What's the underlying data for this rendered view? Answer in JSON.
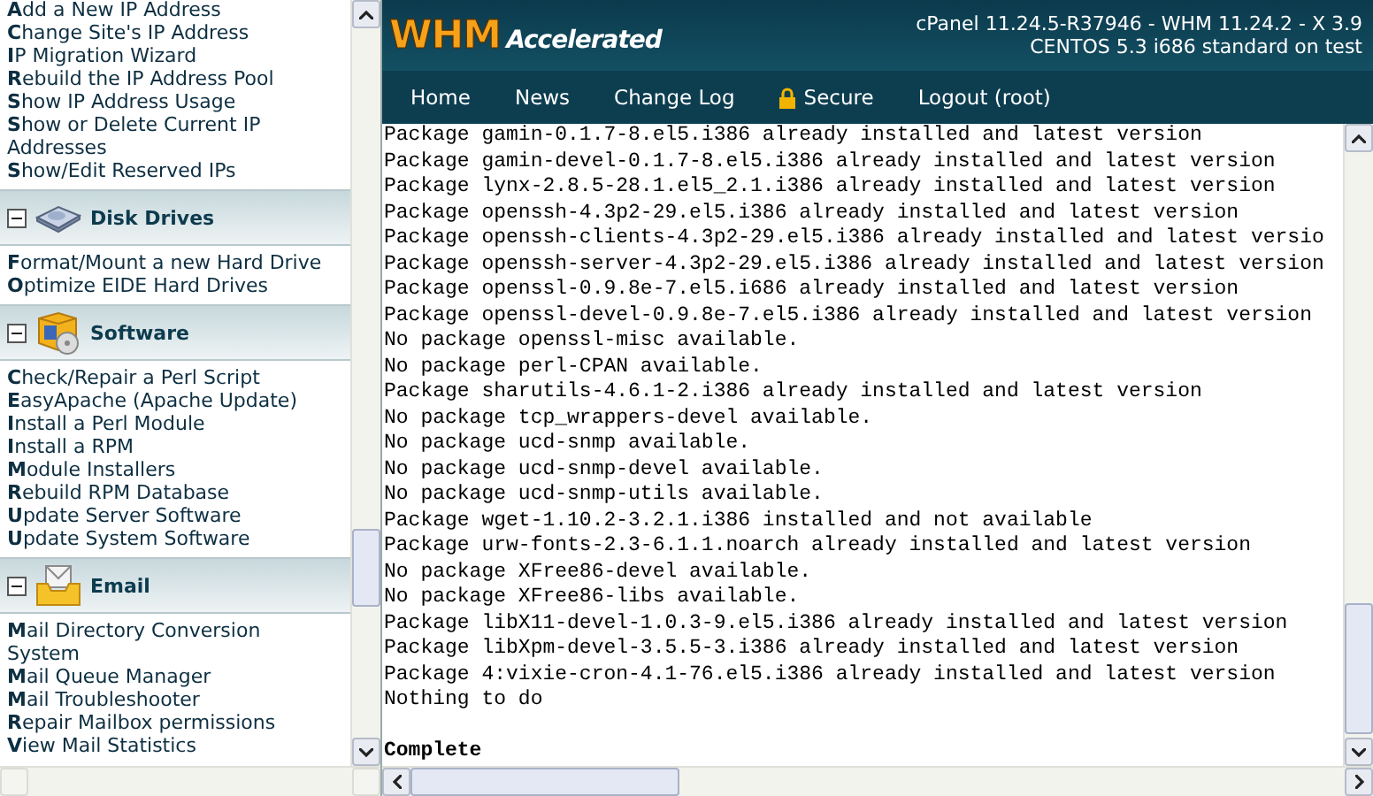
{
  "sidebar": {
    "items_top": [
      "**A**dd a New IP Address",
      "**C**hange Site's IP Address",
      "**I**P Migration Wizard",
      "**R**ebuild the IP Address Pool",
      "**S**how IP Address Usage",
      "**S**how or Delete Current IP Addresses",
      "**S**how/Edit Reserved IPs"
    ],
    "sections": [
      {
        "title": "Disk Drives",
        "kind": "disk",
        "expanded": true,
        "items": [
          "**F**ormat/Mount a new Hard Drive",
          "**O**ptimize EIDE Hard Drives"
        ]
      },
      {
        "title": "Software",
        "kind": "software",
        "expanded": true,
        "items": [
          "**C**heck/Repair a Perl Script",
          "**E**asyApache (Apache Update)",
          "**I**nstall a Perl Module",
          "**I**nstall a RPM",
          "**M**odule Installers",
          "**R**ebuild RPM Database",
          "**U**pdate Server Software",
          "**U**pdate System Software"
        ]
      },
      {
        "title": "Email",
        "kind": "email",
        "expanded": true,
        "items": [
          "**M**ail Directory Conversion System",
          "**M**ail Queue Manager",
          "**M**ail Troubleshooter",
          "**R**epair Mailbox permissions",
          "**V**iew Mail Statistics"
        ]
      }
    ]
  },
  "header": {
    "logo_main": "WHM",
    "logo_sub": "Accelerated",
    "version_lines": [
      "cPanel 11.24.5-R37946 - WHM 11.24.2 - X 3.9",
      "CENTOS 5.3 i686 standard on test"
    ]
  },
  "nav": [
    {
      "label": "Home"
    },
    {
      "label": "News"
    },
    {
      "label": "Change Log"
    },
    {
      "label": "Secure",
      "kind": "secure"
    },
    {
      "label": "Logout (root)"
    }
  ],
  "console": {
    "lines": [
      "Package gamin-0.1.7-8.el5.i386 already installed and latest version",
      "Package gamin-devel-0.1.7-8.el5.i386 already installed and latest version",
      "Package lynx-2.8.5-28.1.el5_2.1.i386 already installed and latest version",
      "Package openssh-4.3p2-29.el5.i386 already installed and latest version",
      "Package openssh-clients-4.3p2-29.el5.i386 already installed and latest versio",
      "Package openssh-server-4.3p2-29.el5.i386 already installed and latest version",
      "Package openssl-0.9.8e-7.el5.i686 already installed and latest version",
      "Package openssl-devel-0.9.8e-7.el5.i386 already installed and latest version",
      "No package openssl-misc available.",
      "No package perl-CPAN available.",
      "Package sharutils-4.6.1-2.i386 already installed and latest version",
      "No package tcp_wrappers-devel available.",
      "No package ucd-snmp available.",
      "No package ucd-snmp-devel available.",
      "No package ucd-snmp-utils available.",
      "Package wget-1.10.2-3.2.1.i386 installed and not available",
      "Package urw-fonts-2.3-6.1.1.noarch already installed and latest version",
      "No package XFree86-devel available.",
      "No package XFree86-libs available.",
      "Package libX11-devel-1.0.3-9.el5.i386 already installed and latest version",
      "Package libXpm-devel-3.5.5-3.i386 already installed and latest version",
      "Package 4:vixie-cron-4.1-76.el5.i386 already installed and latest version",
      "Nothing to do"
    ],
    "status": "Complete"
  }
}
